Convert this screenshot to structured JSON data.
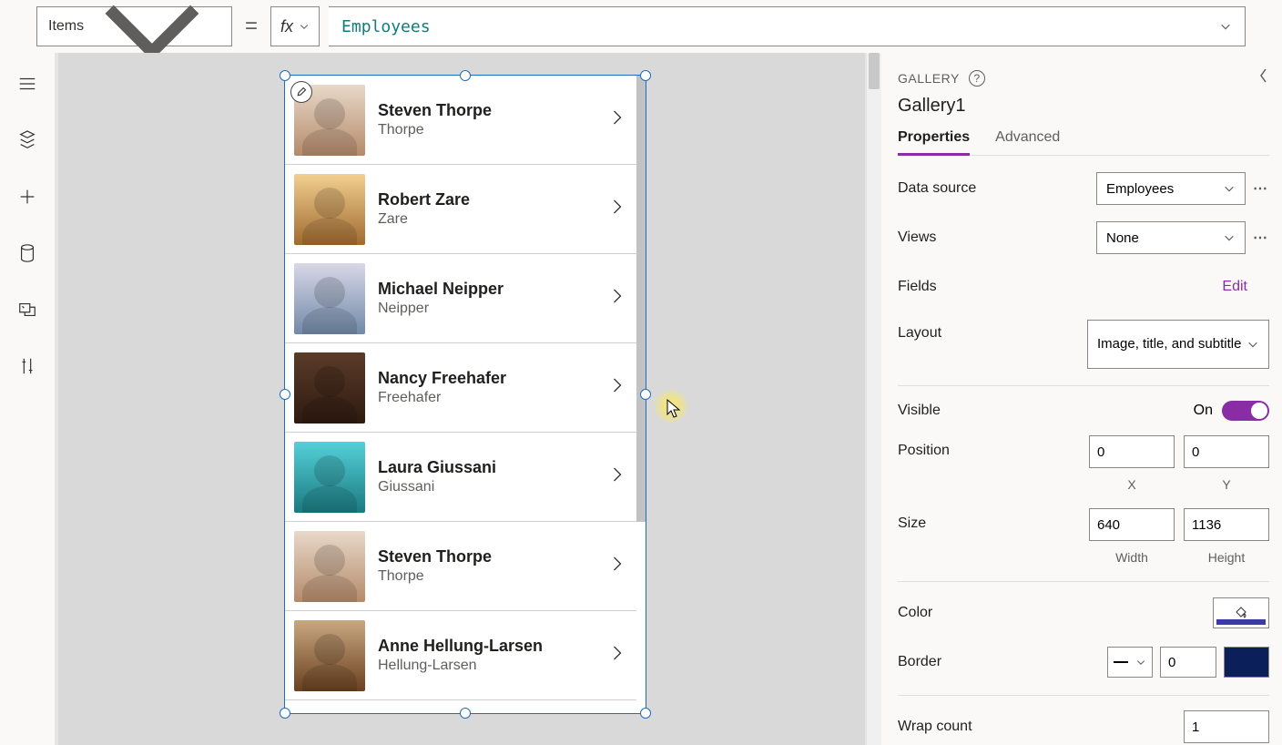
{
  "topbar": {
    "property_dropdown": "Items",
    "fx_label": "fx",
    "formula": "Employees"
  },
  "leftrail": {
    "items": [
      "hamburger",
      "tree-view",
      "insert",
      "data",
      "media",
      "advanced-tools"
    ]
  },
  "gallery": {
    "items": [
      {
        "title": "Steven Thorpe",
        "subtitle": "Thorpe",
        "avatar": "av1"
      },
      {
        "title": "Robert Zare",
        "subtitle": "Zare",
        "avatar": "av2"
      },
      {
        "title": "Michael Neipper",
        "subtitle": "Neipper",
        "avatar": "av3"
      },
      {
        "title": "Nancy Freehafer",
        "subtitle": "Freehafer",
        "avatar": "av4"
      },
      {
        "title": "Laura Giussani",
        "subtitle": "Giussani",
        "avatar": "av5"
      },
      {
        "title": "Steven Thorpe",
        "subtitle": "Thorpe",
        "avatar": "av6"
      },
      {
        "title": "Anne Hellung-Larsen",
        "subtitle": "Hellung-Larsen",
        "avatar": "av7"
      }
    ]
  },
  "rpane": {
    "type_label": "GALLERY",
    "control_name": "Gallery1",
    "tabs": {
      "properties": "Properties",
      "advanced": "Advanced"
    },
    "labels": {
      "data_source": "Data source",
      "views": "Views",
      "fields": "Fields",
      "edit": "Edit",
      "layout": "Layout",
      "visible": "Visible",
      "position": "Position",
      "size": "Size",
      "color": "Color",
      "border": "Border",
      "wrap_count": "Wrap count"
    },
    "values": {
      "data_source": "Employees",
      "views": "None",
      "layout": "Image, title, and subtitle",
      "visible_state": "On",
      "position_x": "0",
      "position_y": "0",
      "size_w": "640",
      "size_h": "1136",
      "x_label": "X",
      "y_label": "Y",
      "w_label": "Width",
      "h_label": "Height",
      "border_width": "0",
      "wrap_count": "1"
    }
  }
}
